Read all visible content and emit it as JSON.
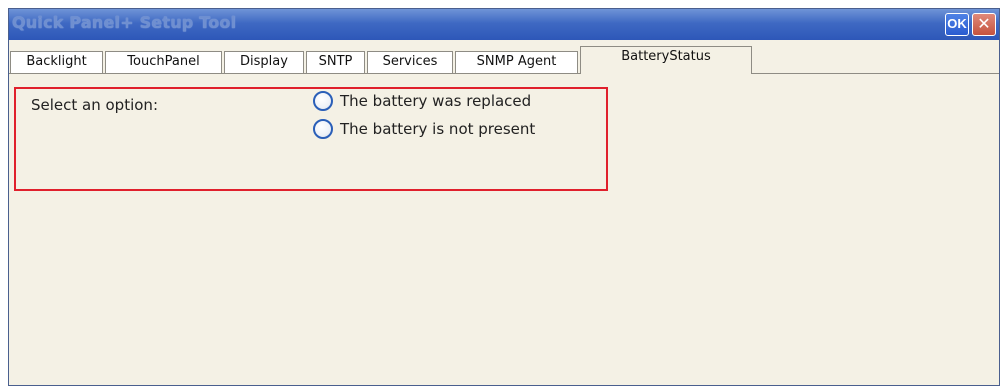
{
  "window": {
    "title": "Quick Panel+ Setup Tool",
    "ok_label": "OK",
    "close_label": "✕"
  },
  "tabs": [
    {
      "label": "Backlight"
    },
    {
      "label": "TouchPanel"
    },
    {
      "label": "Display"
    },
    {
      "label": "SNTP"
    },
    {
      "label": "Services"
    },
    {
      "label": "SNMP Agent"
    },
    {
      "label": "BatteryStatus",
      "active": true
    }
  ],
  "battery_panel": {
    "prompt": "Select an option:",
    "options": [
      {
        "label": "The battery was replaced",
        "selected": false
      },
      {
        "label": "The battery is not present",
        "selected": false
      }
    ]
  },
  "colors": {
    "titlebar": "#2e57b8",
    "panel_bg": "#f4f1e5",
    "highlight": "#e0202c",
    "radio_border": "#2a5fb8",
    "close_button": "#c5533e"
  },
  "icons": {
    "ok": "ok-icon",
    "close": "close-icon",
    "radio": "radio-button-icon"
  }
}
